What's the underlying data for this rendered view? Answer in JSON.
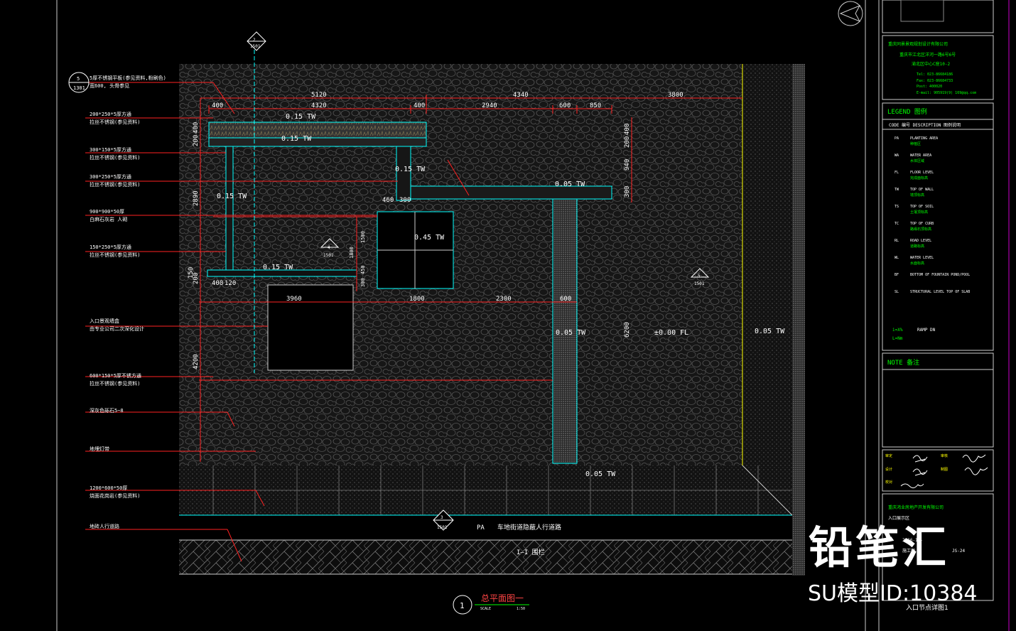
{
  "plan": {
    "dims_top": [
      "5120",
      "4340",
      "3800"
    ],
    "dims_sub": [
      "400",
      "4320",
      "400",
      "2940",
      "600",
      "850"
    ],
    "dims_right": [
      "400",
      "200",
      "940",
      "300"
    ],
    "dims_left": [
      "400",
      "200",
      "2890",
      "150",
      "200",
      "4200"
    ],
    "dims_mid": [
      "3960",
      "1800",
      "2300",
      "600"
    ],
    "dims_small": [
      "460",
      "300",
      "400",
      "120",
      "1800",
      "1500",
      "450",
      "300"
    ],
    "levels": {
      "lv1": "0.15 TW",
      "lv2": "0.15 TW",
      "lv3": "0.15 TW",
      "lv4": "0.05 TW",
      "lv5": "0.15 TW",
      "lv6": "0.45 TW",
      "lv7": "0.15 TW",
      "lv8": "0.05 TW",
      "lv9": "±0.00 FL",
      "lv10": "0.05 TW",
      "lv11": "0.05 TW"
    },
    "section_top": {
      "num": "2",
      "ref": "1501"
    },
    "section_bottom": {
      "num": "3",
      "ref": "1501"
    },
    "section_mid": {
      "num": "4",
      "ref": "1501"
    },
    "section_right": {
      "num": "5",
      "ref": "1501"
    },
    "callout_left": {
      "num": "5",
      "ref": "1301"
    },
    "pa_label": "PA",
    "road_label": "车地街道隐蔽人行道路",
    "boundary_label": "I—I 围栏",
    "title": "总平面图一",
    "title_num": "1",
    "scale_label": "SCALE",
    "scale_value": "1:50"
  },
  "annotations": [
    {
      "l1": "5厚不锈钢平板(参见资料,粉刷色)",
      "l2": "宽600, 头骨参见"
    },
    {
      "l1": "200*250*5厚方通",
      "l2": "拉丝不锈钢(参见资料)"
    },
    {
      "l1": "300*150*5厚方通",
      "l2": "拉丝不锈钢(参见资料)"
    },
    {
      "l1": "300*250*5厚方通",
      "l2": "拉丝不锈钢(参见资料)"
    },
    {
      "l1": "900*900*50厚",
      "l2": "白麻石灰岩 人砌"
    },
    {
      "l1": "150*250*5厚方通",
      "l2": "拉丝不锈钢(参见资料)"
    },
    {
      "l1": "入口景观墙盒",
      "l2": "由专业公司二次深化设计"
    },
    {
      "l1": "600*150*5厚不锈方通",
      "l2": "拉丝不锈钢(参见资料)"
    },
    {
      "l1": "深灰色砾石5~8",
      "l2": ""
    },
    {
      "l1": "地埋灯带",
      "l2": ""
    },
    {
      "l1": "1200*600*50厚",
      "l2": "烧面花岗岩(参见资料)"
    },
    {
      "l1": "地砖人行道路",
      "l2": ""
    }
  ],
  "titleblock": {
    "company": "重庆同景景观规划设计有限公司",
    "address": "重庆市江北区洋河一路6号6号",
    "address2": "渝北区中心C座10-2",
    "tel": "Tel: 023-86684186",
    "fax": "Fax: 023-86684733",
    "post": "Post: 400020",
    "email": "E-mail: 905919(9) 169@qq.com",
    "legend_title": "LEGEND 图例",
    "code_header": "CODE 编号  DESCRIPTION 图例说明",
    "legend": [
      {
        "code": "PA",
        "desc": "PLANTING AREA",
        "cn": "种植区"
      },
      {
        "code": "WA",
        "desc": "WATER AREA",
        "cn": "水体区域"
      },
      {
        "code": "FL",
        "desc": "FLOOR LEVEL",
        "cn": "完成面标高"
      },
      {
        "code": "TW",
        "desc": "TOP OF WALL",
        "cn": "墙顶标高"
      },
      {
        "code": "TS",
        "desc": "TOP OF SOIL",
        "cn": "土壤顶标高"
      },
      {
        "code": "TC",
        "desc": "TOP OF CURB",
        "cn": "路缘石顶标高"
      },
      {
        "code": "RL",
        "desc": "ROAD LEVEL",
        "cn": "道路标高"
      },
      {
        "code": "WL",
        "desc": "WATER LEVEL",
        "cn": "水面标高"
      },
      {
        "code": "BF",
        "desc": "BOTTOM OF FOUNTAIN POND/POOL",
        "cn": ""
      },
      {
        "code": "SL",
        "desc": "STRUCTURAL LEVEL TOP OF SLAB",
        "cn": ""
      }
    ],
    "slope1": "i=X%",
    "ramp": "RAMP DN",
    "slope2": "L=Nm",
    "note_title": "NOTE 备注",
    "sign_rows": [
      "审定",
      "审核",
      "设计",
      "制图",
      "校对"
    ],
    "project_company": "重庆鸿业房地产开发有限公司",
    "project_name": "入口展示区",
    "date": "2016-12-",
    "stage": "施工图",
    "sheet_no": "JS-24",
    "sheet_title": "入口节点详图1"
  },
  "watermark": {
    "brand": "铅笔汇",
    "model_id": "SU模型ID:10384"
  }
}
